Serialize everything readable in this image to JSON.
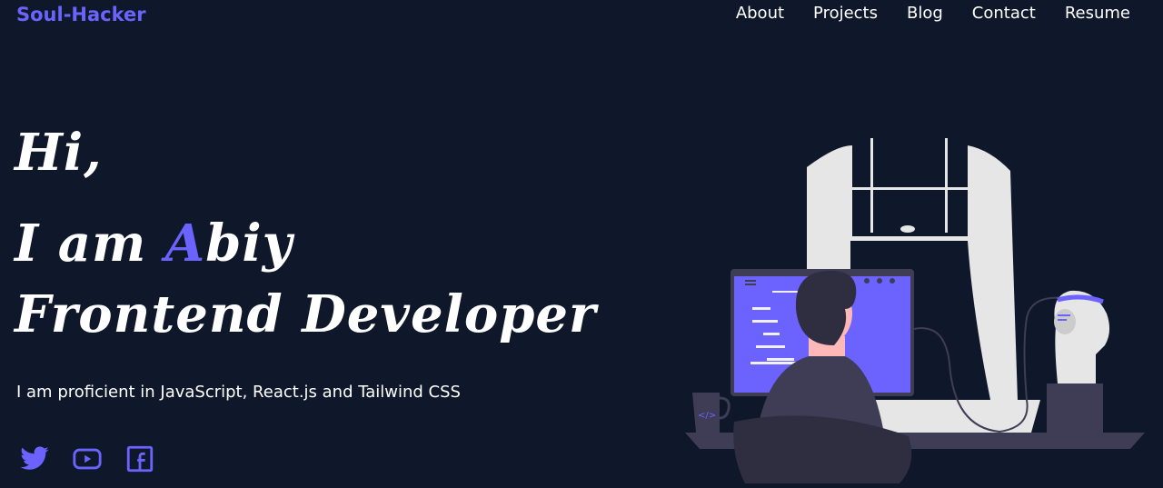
{
  "brand": "Soul-Hacker",
  "nav": [
    "About",
    "Projects",
    "Blog",
    "Contact",
    "Resume"
  ],
  "hero": {
    "greeting": "Hi,",
    "intro_prefix": "I am ",
    "name_accent": "A",
    "name_rest": "biy",
    "role": "Frontend Developer",
    "tagline": "I am proficient in JavaScript, React.js and Tailwind CSS"
  },
  "socials": [
    "twitter-icon",
    "youtube-icon",
    "facebook-icon"
  ],
  "colors": {
    "background": "#0f172a",
    "accent": "#6c63ff",
    "text": "#ffffff",
    "illustration_light": "#e6e6e6",
    "illustration_dark": "#3f3d56"
  }
}
